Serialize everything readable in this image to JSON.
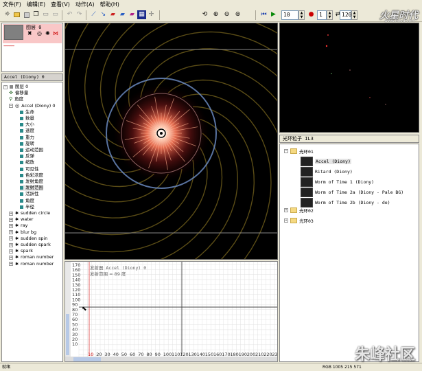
{
  "menu": [
    "文件(F)",
    "编辑(E)",
    "查看(V)",
    "动作(A)",
    "帮助(H)"
  ],
  "toolbar": {
    "frame_value": "10",
    "frame2_value": "1",
    "fps_value": "120",
    "colors": {
      "accent_red": "#cc0000",
      "play_green": "#0a8a0a",
      "nav_blue": "#1a3fb0"
    }
  },
  "layer": {
    "name": "图层 0",
    "dash": "----------"
  },
  "tree": {
    "header": "Accel (Diony) 0",
    "rows": [
      {
        "label": "图层 0",
        "depth": 0,
        "kind": "root"
      },
      {
        "label": "偏移量",
        "depth": 1,
        "kind": "prop"
      },
      {
        "label": "角度",
        "depth": 1,
        "kind": "prop"
      },
      {
        "label": "Accel (Diony) 0",
        "depth": 1,
        "kind": "emitter"
      },
      {
        "label": "生命",
        "depth": 2,
        "kind": "param"
      },
      {
        "label": "数量",
        "depth": 2,
        "kind": "param"
      },
      {
        "label": "大小",
        "depth": 2,
        "kind": "param"
      },
      {
        "label": "速度",
        "depth": 2,
        "kind": "param"
      },
      {
        "label": "重力",
        "depth": 2,
        "kind": "param"
      },
      {
        "label": "旋转",
        "depth": 2,
        "kind": "param"
      },
      {
        "label": "运动范围",
        "depth": 2,
        "kind": "param"
      },
      {
        "label": "反弹",
        "depth": 2,
        "kind": "param"
      },
      {
        "label": "缩放",
        "depth": 2,
        "kind": "param"
      },
      {
        "label": "可见性",
        "depth": 2,
        "kind": "param"
      },
      {
        "label": "色彩浓度",
        "depth": 2,
        "kind": "param"
      },
      {
        "label": "发射角度",
        "depth": 2,
        "kind": "param"
      },
      {
        "label": "发射范围",
        "depth": 2,
        "kind": "param",
        "selected": true
      },
      {
        "label": "活跃性",
        "depth": 2,
        "kind": "param"
      },
      {
        "label": "角度",
        "depth": 2,
        "kind": "param"
      },
      {
        "label": "半径",
        "depth": 2,
        "kind": "param"
      },
      {
        "label": "sudden circle",
        "depth": 1,
        "kind": "sub"
      },
      {
        "label": "water",
        "depth": 1,
        "kind": "sub"
      },
      {
        "label": "ray",
        "depth": 1,
        "kind": "sub"
      },
      {
        "label": "blur bg",
        "depth": 1,
        "kind": "sub"
      },
      {
        "label": "sudden spin",
        "depth": 1,
        "kind": "sub"
      },
      {
        "label": "sudden spark",
        "depth": 1,
        "kind": "sub"
      },
      {
        "label": "spark",
        "depth": 1,
        "kind": "sub"
      },
      {
        "label": "roman number",
        "depth": 1,
        "kind": "sub"
      },
      {
        "label": "roman number",
        "depth": 1,
        "kind": "sub"
      }
    ]
  },
  "library": {
    "header": "光环粒子 IL3",
    "folder1": "光环01",
    "items": [
      "Accel (Diony)",
      "Ritard (Diony)",
      "Worm of Time 1 (Diony)",
      "Worm of Time 2a (Diony - Pale BG)",
      "Worm of Time 2b (Diony - de)"
    ],
    "folder2": "光环02",
    "folder3": "光环03"
  },
  "graph": {
    "info_line1": "发射器  Accel (Diony) 0",
    "info_line2": "发射范围 = 89 度",
    "y_ticks": [
      "170",
      "160",
      "150",
      "140",
      "130",
      "120",
      "110",
      "100",
      "90",
      "80",
      "70",
      "60",
      "50",
      "40",
      "30",
      "20",
      "10"
    ],
    "x_ticks": [
      "10",
      "20",
      "30",
      "40",
      "50",
      "60",
      "70",
      "80",
      "90",
      "100",
      "110",
      "120",
      "130",
      "140",
      "150",
      "160",
      "170",
      "180",
      "190",
      "200",
      "210",
      "220",
      "230"
    ]
  },
  "status": {
    "left": "就绪",
    "right": "RGB   1005   215 571"
  },
  "watermark": {
    "top": "火星时代",
    "top_sub": "www.hxsd.com",
    "bottom": "朱峰社区",
    "bottom_sub": "ZF.COM"
  }
}
